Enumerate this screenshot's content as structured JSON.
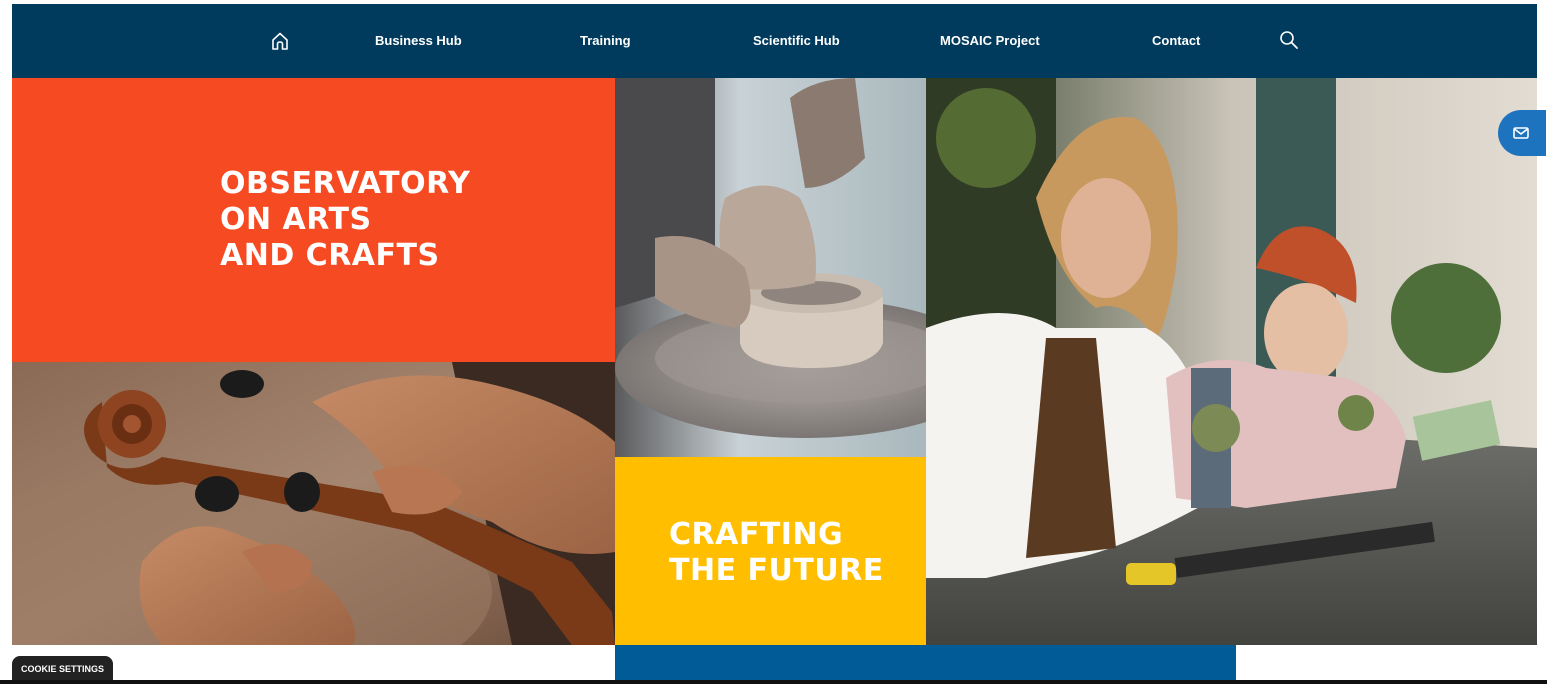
{
  "nav": {
    "home_icon": "home-icon",
    "items": [
      "Business Hub",
      "Training",
      "Scientific Hub",
      "MOSAIC Project",
      "Contact"
    ],
    "search_icon": "search-icon"
  },
  "hero": {
    "observatory_lines": [
      "OBSERVATORY",
      "ON ARTS",
      "AND CRAFTS"
    ],
    "crafting_lines": [
      "CRAFTING",
      "THE FUTURE"
    ],
    "images": {
      "violin": "violin-photo",
      "pottery": "pottery-photo",
      "workshop": "workshop-photo"
    }
  },
  "mail_button": {
    "icon": "mail-icon"
  },
  "cookie": {
    "label": "COOKIE SETTINGS"
  },
  "colors": {
    "nav_bg": "#003a5c",
    "orange": "#f64a22",
    "yellow": "#ffbf00",
    "blue": "#005b96",
    "mail_blue": "#1e73be"
  }
}
